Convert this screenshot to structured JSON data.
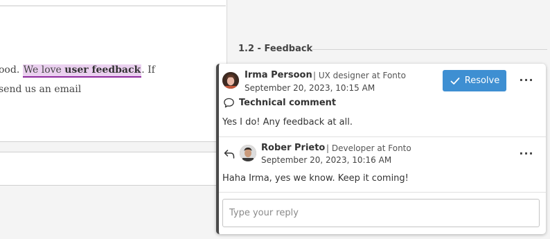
{
  "document": {
    "line1_before": "ood. ",
    "highlight_text": "We love ",
    "highlight_bold": "user feedback",
    "line1_after": ". If",
    "line2": "send us an email"
  },
  "sidebar": {
    "section_heading": "1.2 - Feedback"
  },
  "comment": {
    "author": "Irma Persoon",
    "role": "| UX designer at Fonto",
    "date": "September 20, 2023, 10:15 AM",
    "resolve_label": "Resolve",
    "more_label": "···",
    "type_label": "Technical comment",
    "body": "Yes I do! Any feedback at all."
  },
  "reply": {
    "author": "Rober Prieto",
    "role": "| Developer at Fonto",
    "date": "September 20, 2023, 10:16 AM",
    "more_label": "···",
    "body": "Haha Irma, yes we know. Keep it coming!"
  },
  "reply_input": {
    "placeholder": "Type your reply",
    "value": ""
  },
  "icons": {
    "resolve": "check-icon",
    "type": "speech-bubble-icon",
    "reply": "reply-arrow-icon",
    "more": "more-horizontal-icon"
  },
  "colors": {
    "accent": "#3e8fd2",
    "highlight_bg": "#ead0ef",
    "highlight_underline": "#8e2a9e",
    "card_border": "#4a4a4a"
  }
}
